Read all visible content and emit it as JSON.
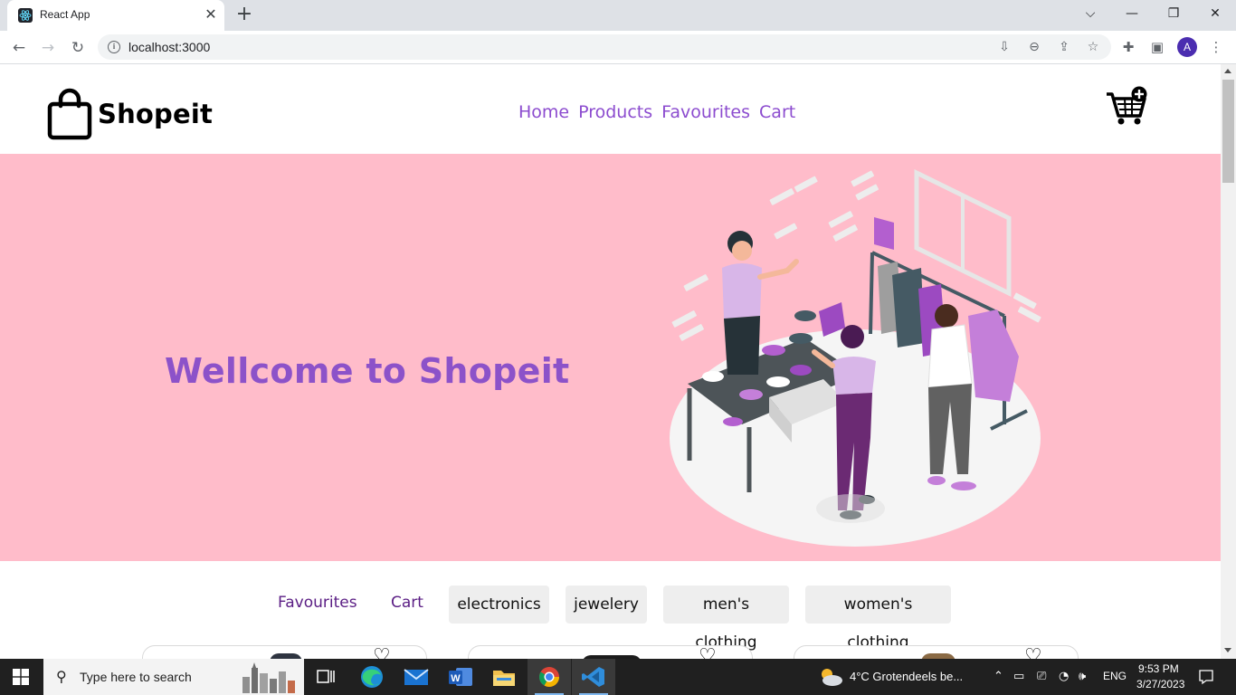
{
  "browser": {
    "tab_title": "React App",
    "tab_close": "✕",
    "new_tab": "+",
    "url": "localhost:3000",
    "profile_initial": "A",
    "window_controls": {
      "chevron": "⌵",
      "minimize": "—",
      "restore": "❐",
      "close": "✕"
    }
  },
  "site": {
    "brand": "Shopeit",
    "nav": [
      "Home",
      "Products",
      "Favourites",
      "Cart"
    ],
    "hero_title": "Wellcome to Shopeit",
    "filters": {
      "links": [
        "Favourites",
        "Cart"
      ],
      "categories": [
        "electronics",
        "jewelery",
        "men's clothing",
        "women's clothing"
      ]
    },
    "card_icon": "heart-outline-icon"
  },
  "colors": {
    "hero_bg": "#ffbcca",
    "accent_purple": "#8c52c9",
    "nav_purple": "#8c4ccf",
    "dark_purple": "#5a1d84"
  },
  "taskbar": {
    "search_placeholder": "Type here to search",
    "weather": "4°C  Grotendeels be...",
    "language": "ENG",
    "time": "9:53 PM",
    "date": "3/27/2023"
  }
}
